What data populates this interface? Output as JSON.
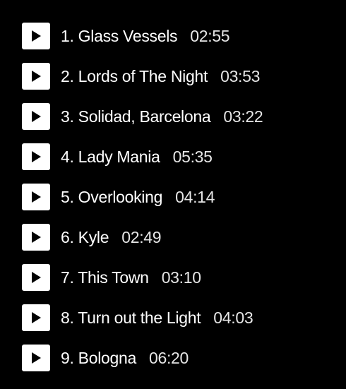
{
  "colors": {
    "background": "#000000",
    "text": "#ffffff",
    "button": "#ffffff",
    "button_icon": "#000000"
  },
  "tracks": [
    {
      "title": "1. Glass Vessels",
      "duration": "02:55",
      "icon": "play-icon"
    },
    {
      "title": "2. Lords of The Night",
      "duration": "03:53",
      "icon": "play-icon"
    },
    {
      "title": "3. Solidad, Barcelona",
      "duration": "03:22",
      "icon": "play-icon"
    },
    {
      "title": "4. Lady Mania",
      "duration": "05:35",
      "icon": "play-icon"
    },
    {
      "title": "5. Overlooking",
      "duration": "04:14",
      "icon": "play-icon"
    },
    {
      "title": "6. Kyle",
      "duration": "02:49",
      "icon": "play-icon"
    },
    {
      "title": "7. This Town",
      "duration": "03:10",
      "icon": "play-icon"
    },
    {
      "title": "8. Turn out the Light",
      "duration": "04:03",
      "icon": "play-icon"
    },
    {
      "title": "9. Bologna",
      "duration": "06:20",
      "icon": "play-icon"
    }
  ]
}
